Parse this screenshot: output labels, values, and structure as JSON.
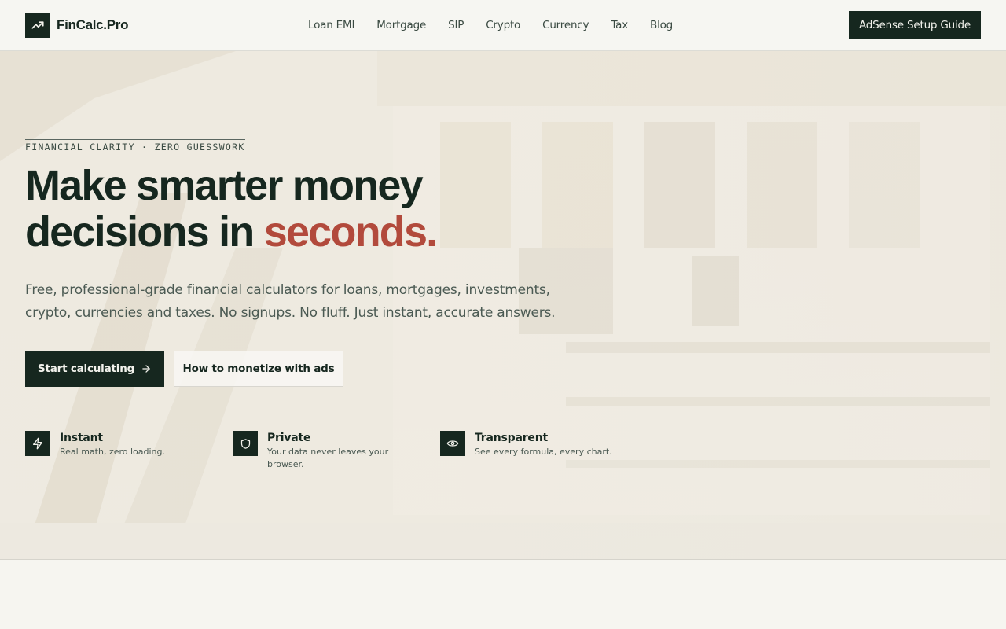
{
  "header": {
    "logo_text": "FinCalc.Pro",
    "logo_icon": "trending-up-icon",
    "nav": [
      "Loan EMI",
      "Mortgage",
      "SIP",
      "Crypto",
      "Currency",
      "Tax",
      "Blog"
    ],
    "cta_label": "AdSense Setup Guide"
  },
  "hero": {
    "eyebrow": "FINANCIAL CLARITY · ZERO GUESSWORK",
    "headline_line1": "Make smarter money",
    "headline_line2_prefix": "decisions in ",
    "headline_accent": "seconds.",
    "subtext": "Free, professional-grade financial calculators for loans, mortgages, investments, crypto, currencies and taxes. No signups. No fluff. Just instant, accurate answers.",
    "primary_cta": "Start calculating",
    "primary_cta_icon": "arrow-right-icon",
    "secondary_cta": "How to monetize with ads"
  },
  "features": [
    {
      "icon": "lightning-icon",
      "title": "Instant",
      "desc": "Real math, zero loading."
    },
    {
      "icon": "shield-icon",
      "title": "Private",
      "desc": "Your data never leaves your browser."
    },
    {
      "icon": "eye-icon",
      "title": "Transparent",
      "desc": "See every formula, every chart."
    }
  ],
  "colors": {
    "brand_dark": "#16271f",
    "accent": "#b24a3c",
    "background": "#f6f5f0"
  }
}
